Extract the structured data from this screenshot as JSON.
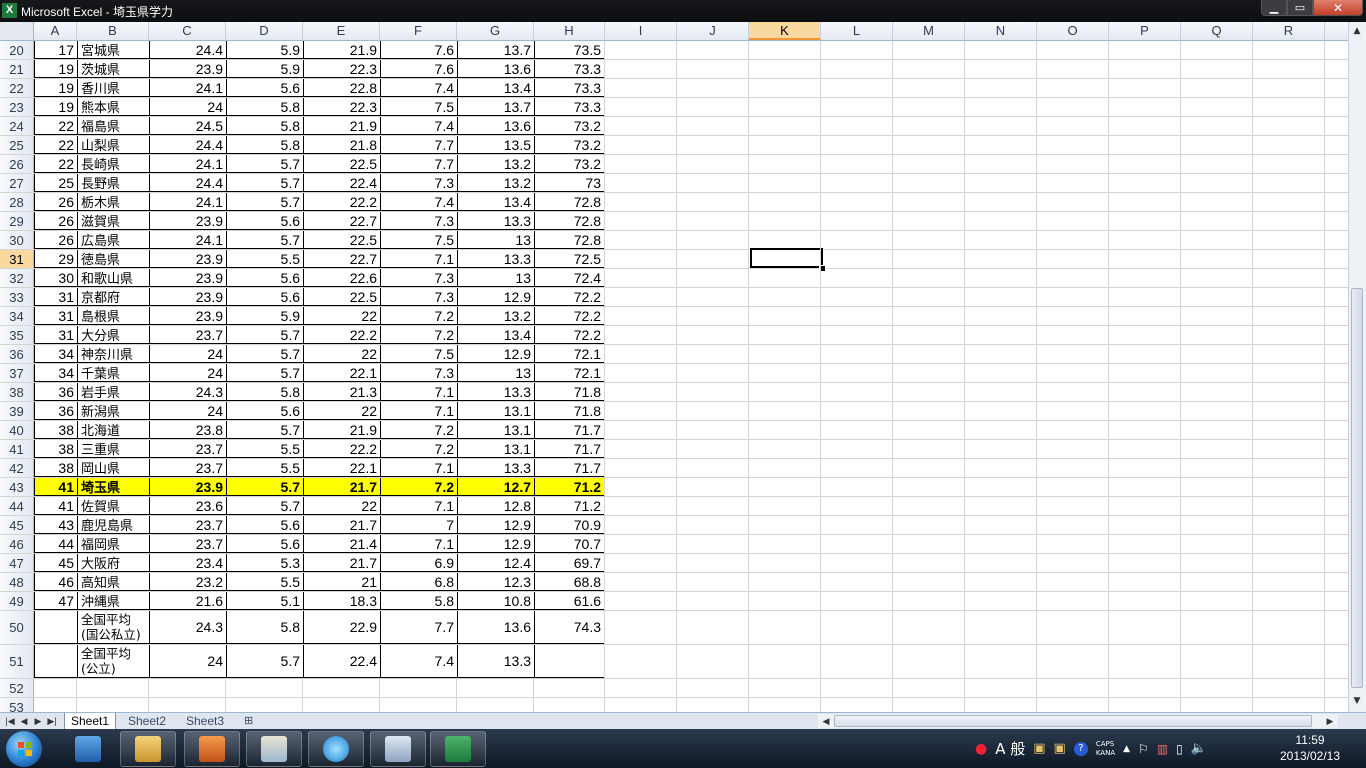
{
  "window": {
    "title": "Microsoft Excel - 埼玉県学力",
    "min": "▁",
    "max": "▭",
    "close": "✕"
  },
  "columns": [
    "A",
    "B",
    "C",
    "D",
    "E",
    "F",
    "G",
    "H",
    "I",
    "J",
    "K",
    "L",
    "M",
    "N",
    "O",
    "P",
    "Q",
    "R"
  ],
  "selected_column": "K",
  "selected_row": "31",
  "rows": [
    {
      "n": "20",
      "a": "17",
      "b": "宮城県",
      "c": "24.4",
      "d": "5.9",
      "e": "21.9",
      "f": "7.6",
      "g": "13.7",
      "h": "73.5"
    },
    {
      "n": "21",
      "a": "19",
      "b": "茨城県",
      "c": "23.9",
      "d": "5.9",
      "e": "22.3",
      "f": "7.6",
      "g": "13.6",
      "h": "73.3"
    },
    {
      "n": "22",
      "a": "19",
      "b": "香川県",
      "c": "24.1",
      "d": "5.6",
      "e": "22.8",
      "f": "7.4",
      "g": "13.4",
      "h": "73.3"
    },
    {
      "n": "23",
      "a": "19",
      "b": "熊本県",
      "c": "24",
      "d": "5.8",
      "e": "22.3",
      "f": "7.5",
      "g": "13.7",
      "h": "73.3"
    },
    {
      "n": "24",
      "a": "22",
      "b": "福島県",
      "c": "24.5",
      "d": "5.8",
      "e": "21.9",
      "f": "7.4",
      "g": "13.6",
      "h": "73.2"
    },
    {
      "n": "25",
      "a": "22",
      "b": "山梨県",
      "c": "24.4",
      "d": "5.8",
      "e": "21.8",
      "f": "7.7",
      "g": "13.5",
      "h": "73.2"
    },
    {
      "n": "26",
      "a": "22",
      "b": "長崎県",
      "c": "24.1",
      "d": "5.7",
      "e": "22.5",
      "f": "7.7",
      "g": "13.2",
      "h": "73.2"
    },
    {
      "n": "27",
      "a": "25",
      "b": "長野県",
      "c": "24.4",
      "d": "5.7",
      "e": "22.4",
      "f": "7.3",
      "g": "13.2",
      "h": "73"
    },
    {
      "n": "28",
      "a": "26",
      "b": "栃木県",
      "c": "24.1",
      "d": "5.7",
      "e": "22.2",
      "f": "7.4",
      "g": "13.4",
      "h": "72.8"
    },
    {
      "n": "29",
      "a": "26",
      "b": "滋賀県",
      "c": "23.9",
      "d": "5.6",
      "e": "22.7",
      "f": "7.3",
      "g": "13.3",
      "h": "72.8"
    },
    {
      "n": "30",
      "a": "26",
      "b": "広島県",
      "c": "24.1",
      "d": "5.7",
      "e": "22.5",
      "f": "7.5",
      "g": "13",
      "h": "72.8"
    },
    {
      "n": "31",
      "a": "29",
      "b": "徳島県",
      "c": "23.9",
      "d": "5.5",
      "e": "22.7",
      "f": "7.1",
      "g": "13.3",
      "h": "72.5"
    },
    {
      "n": "32",
      "a": "30",
      "b": "和歌山県",
      "c": "23.9",
      "d": "5.6",
      "e": "22.6",
      "f": "7.3",
      "g": "13",
      "h": "72.4"
    },
    {
      "n": "33",
      "a": "31",
      "b": "京都府",
      "c": "23.9",
      "d": "5.6",
      "e": "22.5",
      "f": "7.3",
      "g": "12.9",
      "h": "72.2"
    },
    {
      "n": "34",
      "a": "31",
      "b": "島根県",
      "c": "23.9",
      "d": "5.9",
      "e": "22",
      "f": "7.2",
      "g": "13.2",
      "h": "72.2"
    },
    {
      "n": "35",
      "a": "31",
      "b": "大分県",
      "c": "23.7",
      "d": "5.7",
      "e": "22.2",
      "f": "7.2",
      "g": "13.4",
      "h": "72.2"
    },
    {
      "n": "36",
      "a": "34",
      "b": "神奈川県",
      "c": "24",
      "d": "5.7",
      "e": "22",
      "f": "7.5",
      "g": "12.9",
      "h": "72.1"
    },
    {
      "n": "37",
      "a": "34",
      "b": "千葉県",
      "c": "24",
      "d": "5.7",
      "e": "22.1",
      "f": "7.3",
      "g": "13",
      "h": "72.1"
    },
    {
      "n": "38",
      "a": "36",
      "b": "岩手県",
      "c": "24.3",
      "d": "5.8",
      "e": "21.3",
      "f": "7.1",
      "g": "13.3",
      "h": "71.8"
    },
    {
      "n": "39",
      "a": "36",
      "b": "新潟県",
      "c": "24",
      "d": "5.6",
      "e": "22",
      "f": "7.1",
      "g": "13.1",
      "h": "71.8"
    },
    {
      "n": "40",
      "a": "38",
      "b": "北海道",
      "c": "23.8",
      "d": "5.7",
      "e": "21.9",
      "f": "7.2",
      "g": "13.1",
      "h": "71.7"
    },
    {
      "n": "41",
      "a": "38",
      "b": "三重県",
      "c": "23.7",
      "d": "5.5",
      "e": "22.2",
      "f": "7.2",
      "g": "13.1",
      "h": "71.7"
    },
    {
      "n": "42",
      "a": "38",
      "b": "岡山県",
      "c": "23.7",
      "d": "5.5",
      "e": "22.1",
      "f": "7.1",
      "g": "13.3",
      "h": "71.7"
    },
    {
      "n": "43",
      "a": "41",
      "b": "埼玉県",
      "c": "23.9",
      "d": "5.7",
      "e": "21.7",
      "f": "7.2",
      "g": "12.7",
      "h": "71.2",
      "highlight": true
    },
    {
      "n": "44",
      "a": "41",
      "b": "佐賀県",
      "c": "23.6",
      "d": "5.7",
      "e": "22",
      "f": "7.1",
      "g": "12.8",
      "h": "71.2"
    },
    {
      "n": "45",
      "a": "43",
      "b": "鹿児島県",
      "c": "23.7",
      "d": "5.6",
      "e": "21.7",
      "f": "7",
      "g": "12.9",
      "h": "70.9"
    },
    {
      "n": "46",
      "a": "44",
      "b": "福岡県",
      "c": "23.7",
      "d": "5.6",
      "e": "21.4",
      "f": "7.1",
      "g": "12.9",
      "h": "70.7"
    },
    {
      "n": "47",
      "a": "45",
      "b": "大阪府",
      "c": "23.4",
      "d": "5.3",
      "e": "21.7",
      "f": "6.9",
      "g": "12.4",
      "h": "69.7"
    },
    {
      "n": "48",
      "a": "46",
      "b": "高知県",
      "c": "23.2",
      "d": "5.5",
      "e": "21",
      "f": "6.8",
      "g": "12.3",
      "h": "68.8"
    },
    {
      "n": "49",
      "a": "47",
      "b": "沖縄県",
      "c": "21.6",
      "d": "5.1",
      "e": "18.3",
      "f": "5.8",
      "g": "10.8",
      "h": "61.6"
    },
    {
      "n": "50",
      "a": "",
      "b1": "全国平均",
      "b2": "(国公私立)",
      "c": "24.3",
      "d": "5.8",
      "e": "22.9",
      "f": "7.7",
      "g": "13.6",
      "h": "74.3",
      "tall": true
    },
    {
      "n": "51",
      "a": "",
      "b1": "全国平均",
      "b2": "(公立)",
      "c": "24",
      "d": "5.7",
      "e": "22.4",
      "f": "7.4",
      "g": "13.3",
      "h": "",
      "tall": true
    },
    {
      "n": "52"
    },
    {
      "n": "53"
    }
  ],
  "sheet_tabs": [
    "Sheet1",
    "Sheet2",
    "Sheet3"
  ],
  "active_tab": "Sheet1",
  "taskbar": {
    "ime": "A 般",
    "caps": "CAPS",
    "kana": "KANA",
    "time": "11:59",
    "date": "2013/02/13"
  },
  "colors": {
    "highlight": "#ffff00",
    "selected_header": "#f9d99f",
    "excel_green": "#1e7a3c"
  }
}
